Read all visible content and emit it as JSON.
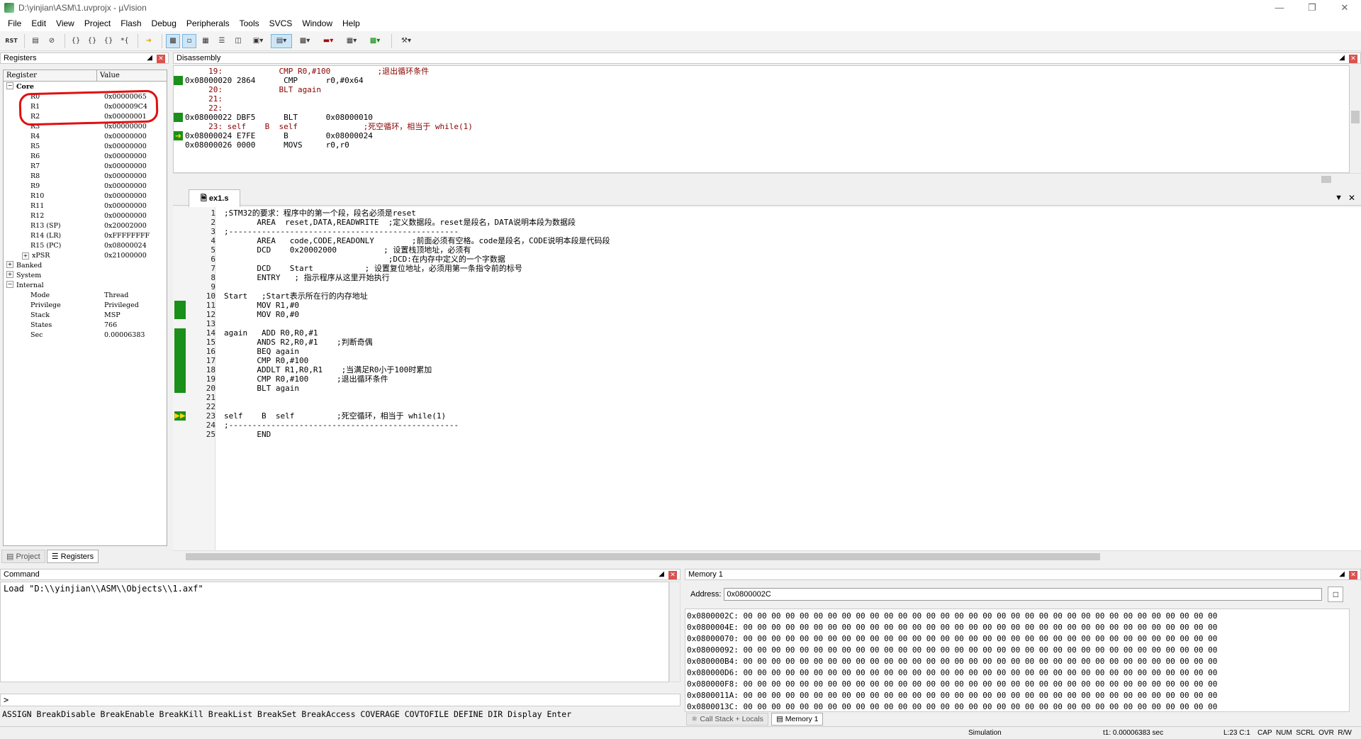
{
  "window": {
    "title": "D:\\yinjian\\ASM\\1.uvprojx - µVision"
  },
  "menu": [
    "File",
    "Edit",
    "View",
    "Project",
    "Flash",
    "Debug",
    "Peripherals",
    "Tools",
    "SVCS",
    "Window",
    "Help"
  ],
  "toolbar_label_rst": "RST",
  "registers": {
    "title": "Registers",
    "col_register": "Register",
    "col_value": "Value",
    "core": "Core",
    "rows": [
      {
        "name": "R0",
        "value": "0x00000065"
      },
      {
        "name": "R1",
        "value": "0x000009C4"
      },
      {
        "name": "R2",
        "value": "0x00000001"
      },
      {
        "name": "R3",
        "value": "0x00000000"
      },
      {
        "name": "R4",
        "value": "0x00000000"
      },
      {
        "name": "R5",
        "value": "0x00000000"
      },
      {
        "name": "R6",
        "value": "0x00000000"
      },
      {
        "name": "R7",
        "value": "0x00000000"
      },
      {
        "name": "R8",
        "value": "0x00000000"
      },
      {
        "name": "R9",
        "value": "0x00000000"
      },
      {
        "name": "R10",
        "value": "0x00000000"
      },
      {
        "name": "R11",
        "value": "0x00000000"
      },
      {
        "name": "R12",
        "value": "0x00000000"
      },
      {
        "name": "R13 (SP)",
        "value": "0x20002000"
      },
      {
        "name": "R14 (LR)",
        "value": "0xFFFFFFFF"
      },
      {
        "name": "R15 (PC)",
        "value": "0x08000024"
      },
      {
        "name": "xPSR",
        "value": "0x21000000"
      }
    ],
    "banked": "Banked",
    "system": "System",
    "internal": "Internal",
    "internal_rows": [
      {
        "name": "Mode",
        "value": "Thread"
      },
      {
        "name": "Privilege",
        "value": "Privileged"
      },
      {
        "name": "Stack",
        "value": "MSP"
      },
      {
        "name": "States",
        "value": "766"
      },
      {
        "name": "Sec",
        "value": "0.00006383"
      }
    ],
    "tab_project": "Project",
    "tab_registers": "Registers"
  },
  "disassembly": {
    "title": "Disassembly",
    "lines": [
      "     19:            CMP R0,#100          ;退出循环条件",
      "0x08000020 2864      CMP      r0,#0x64",
      "     20:            BLT again",
      "     21:",
      "     22:",
      "0x08000022 DBF5      BLT      0x08000010",
      "     23: self    B  self              ;死空循环，相当于 while(1)",
      "0x08000024 E7FE      B        0x08000024",
      "0x08000026 0000      MOVS     r0,r0"
    ]
  },
  "editor": {
    "tab": "ex1.s",
    "lines": [
      {
        "n": "1",
        "t": ";STM32的要求：程序中的第一个段，段名必须是reset"
      },
      {
        "n": "2",
        "t": "       AREA  reset,DATA,READWRITE  ;定义数据段。reset是段名，DATA说明本段为数据段"
      },
      {
        "n": "3",
        "t": ";-------------------------------------------------"
      },
      {
        "n": "4",
        "t": "       AREA   code,CODE,READONLY        ;前面必须有空格。code是段名，CODE说明本段是代码段"
      },
      {
        "n": "5",
        "t": "       DCD    0x20002000          ; 设置栈顶地址，必须有"
      },
      {
        "n": "6",
        "t": "                                   ;DCD:在内存中定义的一个字数据"
      },
      {
        "n": "7",
        "t": "       DCD    Start           ; 设置复位地址，必须用第一条指令前的标号"
      },
      {
        "n": "8",
        "t": "       ENTRY   ; 指示程序从这里开始执行"
      },
      {
        "n": "9",
        "t": ""
      },
      {
        "n": "10",
        "t": "Start   ;Start表示所在行的内存地址"
      },
      {
        "n": "11",
        "t": "       MOV R1,#0"
      },
      {
        "n": "12",
        "t": "       MOV R0,#0"
      },
      {
        "n": "13",
        "t": ""
      },
      {
        "n": "14",
        "t": "again   ADD R0,R0,#1"
      },
      {
        "n": "15",
        "t": "       ANDS R2,R0,#1    ;判断奇偶"
      },
      {
        "n": "16",
        "t": "       BEQ again"
      },
      {
        "n": "17",
        "t": "       CMP R0,#100"
      },
      {
        "n": "18",
        "t": "       ADDLT R1,R0,R1    ;当满足R0小于100时累加"
      },
      {
        "n": "19",
        "t": "       CMP R0,#100      ;退出循环条件"
      },
      {
        "n": "20",
        "t": "       BLT again"
      },
      {
        "n": "21",
        "t": ""
      },
      {
        "n": "22",
        "t": ""
      },
      {
        "n": "23",
        "t": "self    B  self         ;死空循环，相当于 while(1)"
      },
      {
        "n": "24",
        "t": ";-------------------------------------------------"
      },
      {
        "n": "25",
        "t": "       END"
      }
    ]
  },
  "command": {
    "title": "Command",
    "output": "Load \"D:\\\\yinjian\\\\ASM\\\\Objects\\\\1.axf\"",
    "prompt": ">",
    "hints": "ASSIGN BreakDisable BreakEnable BreakKill BreakList BreakSet BreakAccess COVERAGE COVTOFILE DEFINE DIR Display Enter"
  },
  "memory": {
    "title": "Memory 1",
    "address_label": "Address:",
    "address_value": "0x0800002C",
    "rows": [
      "0x0800002C:",
      "0x0800004E:",
      "0x08000070:",
      "0x08000092:",
      "0x080000B4:",
      "0x080000D6:",
      "0x080000F8:",
      "0x0800011A:",
      "0x0800013C:"
    ],
    "bytes": "00 00 00 00 00 00 00 00 00 00 00 00 00 00 00 00 00 00 00 00 00 00 00 00 00 00 00 00 00 00 00 00 00 00",
    "tab_callstack": "Call Stack + Locals",
    "tab_memory": "Memory 1"
  },
  "status": {
    "mode": "Simulation",
    "time": "t1: 0.00006383 sec",
    "pos": "L:23 C:1",
    "flags": "CAP  NUM  SCRL  OVR  R/W"
  }
}
